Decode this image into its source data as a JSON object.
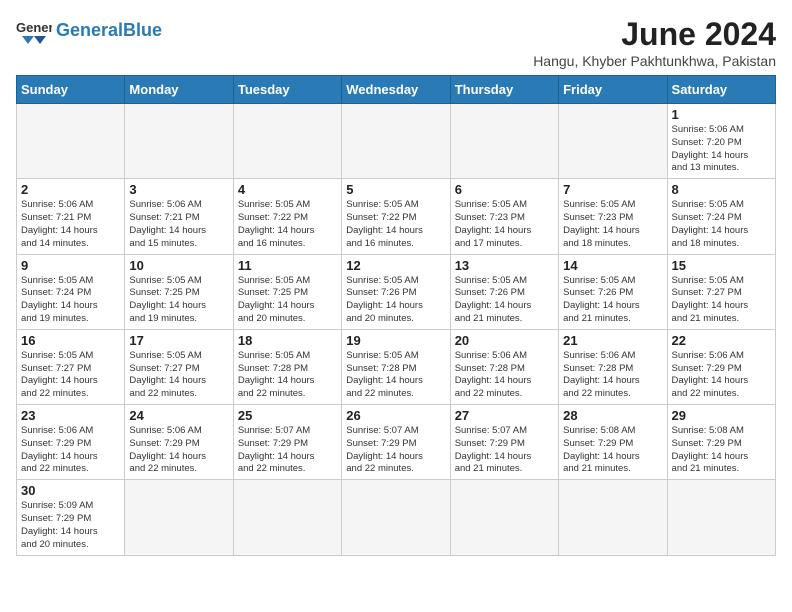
{
  "header": {
    "logo_text_black": "General",
    "logo_text_blue": "Blue",
    "month_title": "June 2024",
    "subtitle": "Hangu, Khyber Pakhtunkhwa, Pakistan"
  },
  "weekdays": [
    "Sunday",
    "Monday",
    "Tuesday",
    "Wednesday",
    "Thursday",
    "Friday",
    "Saturday"
  ],
  "weeks": [
    [
      {
        "day": "",
        "info": ""
      },
      {
        "day": "",
        "info": ""
      },
      {
        "day": "",
        "info": ""
      },
      {
        "day": "",
        "info": ""
      },
      {
        "day": "",
        "info": ""
      },
      {
        "day": "",
        "info": ""
      },
      {
        "day": "1",
        "info": "Sunrise: 5:06 AM\nSunset: 7:20 PM\nDaylight: 14 hours\nand 13 minutes."
      }
    ],
    [
      {
        "day": "2",
        "info": "Sunrise: 5:06 AM\nSunset: 7:21 PM\nDaylight: 14 hours\nand 14 minutes."
      },
      {
        "day": "3",
        "info": "Sunrise: 5:06 AM\nSunset: 7:21 PM\nDaylight: 14 hours\nand 15 minutes."
      },
      {
        "day": "4",
        "info": "Sunrise: 5:05 AM\nSunset: 7:22 PM\nDaylight: 14 hours\nand 16 minutes."
      },
      {
        "day": "5",
        "info": "Sunrise: 5:05 AM\nSunset: 7:22 PM\nDaylight: 14 hours\nand 16 minutes."
      },
      {
        "day": "6",
        "info": "Sunrise: 5:05 AM\nSunset: 7:23 PM\nDaylight: 14 hours\nand 17 minutes."
      },
      {
        "day": "7",
        "info": "Sunrise: 5:05 AM\nSunset: 7:23 PM\nDaylight: 14 hours\nand 18 minutes."
      },
      {
        "day": "8",
        "info": "Sunrise: 5:05 AM\nSunset: 7:24 PM\nDaylight: 14 hours\nand 18 minutes."
      }
    ],
    [
      {
        "day": "9",
        "info": "Sunrise: 5:05 AM\nSunset: 7:24 PM\nDaylight: 14 hours\nand 19 minutes."
      },
      {
        "day": "10",
        "info": "Sunrise: 5:05 AM\nSunset: 7:25 PM\nDaylight: 14 hours\nand 19 minutes."
      },
      {
        "day": "11",
        "info": "Sunrise: 5:05 AM\nSunset: 7:25 PM\nDaylight: 14 hours\nand 20 minutes."
      },
      {
        "day": "12",
        "info": "Sunrise: 5:05 AM\nSunset: 7:26 PM\nDaylight: 14 hours\nand 20 minutes."
      },
      {
        "day": "13",
        "info": "Sunrise: 5:05 AM\nSunset: 7:26 PM\nDaylight: 14 hours\nand 21 minutes."
      },
      {
        "day": "14",
        "info": "Sunrise: 5:05 AM\nSunset: 7:26 PM\nDaylight: 14 hours\nand 21 minutes."
      },
      {
        "day": "15",
        "info": "Sunrise: 5:05 AM\nSunset: 7:27 PM\nDaylight: 14 hours\nand 21 minutes."
      }
    ],
    [
      {
        "day": "16",
        "info": "Sunrise: 5:05 AM\nSunset: 7:27 PM\nDaylight: 14 hours\nand 22 minutes."
      },
      {
        "day": "17",
        "info": "Sunrise: 5:05 AM\nSunset: 7:27 PM\nDaylight: 14 hours\nand 22 minutes."
      },
      {
        "day": "18",
        "info": "Sunrise: 5:05 AM\nSunset: 7:28 PM\nDaylight: 14 hours\nand 22 minutes."
      },
      {
        "day": "19",
        "info": "Sunrise: 5:05 AM\nSunset: 7:28 PM\nDaylight: 14 hours\nand 22 minutes."
      },
      {
        "day": "20",
        "info": "Sunrise: 5:06 AM\nSunset: 7:28 PM\nDaylight: 14 hours\nand 22 minutes."
      },
      {
        "day": "21",
        "info": "Sunrise: 5:06 AM\nSunset: 7:28 PM\nDaylight: 14 hours\nand 22 minutes."
      },
      {
        "day": "22",
        "info": "Sunrise: 5:06 AM\nSunset: 7:29 PM\nDaylight: 14 hours\nand 22 minutes."
      }
    ],
    [
      {
        "day": "23",
        "info": "Sunrise: 5:06 AM\nSunset: 7:29 PM\nDaylight: 14 hours\nand 22 minutes."
      },
      {
        "day": "24",
        "info": "Sunrise: 5:06 AM\nSunset: 7:29 PM\nDaylight: 14 hours\nand 22 minutes."
      },
      {
        "day": "25",
        "info": "Sunrise: 5:07 AM\nSunset: 7:29 PM\nDaylight: 14 hours\nand 22 minutes."
      },
      {
        "day": "26",
        "info": "Sunrise: 5:07 AM\nSunset: 7:29 PM\nDaylight: 14 hours\nand 22 minutes."
      },
      {
        "day": "27",
        "info": "Sunrise: 5:07 AM\nSunset: 7:29 PM\nDaylight: 14 hours\nand 21 minutes."
      },
      {
        "day": "28",
        "info": "Sunrise: 5:08 AM\nSunset: 7:29 PM\nDaylight: 14 hours\nand 21 minutes."
      },
      {
        "day": "29",
        "info": "Sunrise: 5:08 AM\nSunset: 7:29 PM\nDaylight: 14 hours\nand 21 minutes."
      }
    ],
    [
      {
        "day": "30",
        "info": "Sunrise: 5:09 AM\nSunset: 7:29 PM\nDaylight: 14 hours\nand 20 minutes."
      },
      {
        "day": "",
        "info": ""
      },
      {
        "day": "",
        "info": ""
      },
      {
        "day": "",
        "info": ""
      },
      {
        "day": "",
        "info": ""
      },
      {
        "day": "",
        "info": ""
      },
      {
        "day": "",
        "info": ""
      }
    ]
  ]
}
